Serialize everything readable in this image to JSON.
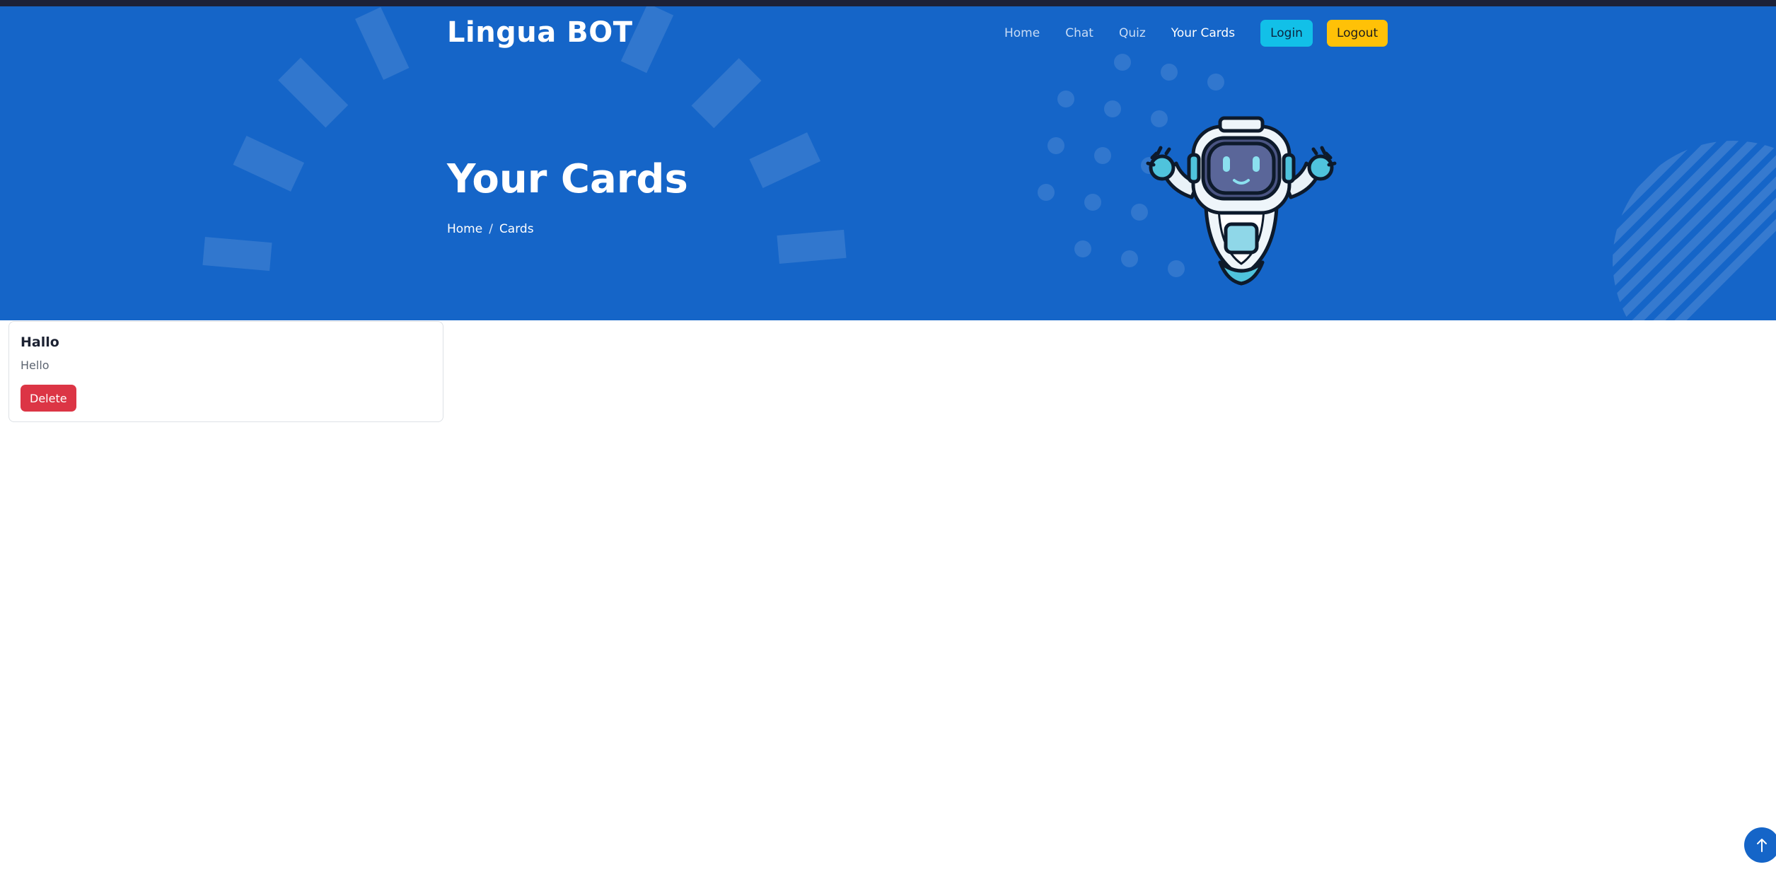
{
  "header": {
    "brand": "Lingua BOT",
    "nav": [
      {
        "label": "Home"
      },
      {
        "label": "Chat"
      },
      {
        "label": "Quiz"
      },
      {
        "label": "Your Cards"
      }
    ],
    "login_label": "Login",
    "logout_label": "Logout"
  },
  "hero": {
    "title": "Your Cards",
    "breadcrumb": {
      "home": "Home",
      "separator": "/",
      "current": "Cards"
    }
  },
  "cards": [
    {
      "title": "Hallo",
      "text": "Hello",
      "delete_label": "Delete"
    }
  ],
  "icons": {
    "scroll_top": "arrow-up-icon",
    "mascot": "robot-astronaut-illustration"
  },
  "colors": {
    "hero_bg": "#1565c8",
    "login_btn": "#12c0e8",
    "logout_btn": "#ffc107",
    "delete_btn": "#dc3545"
  }
}
